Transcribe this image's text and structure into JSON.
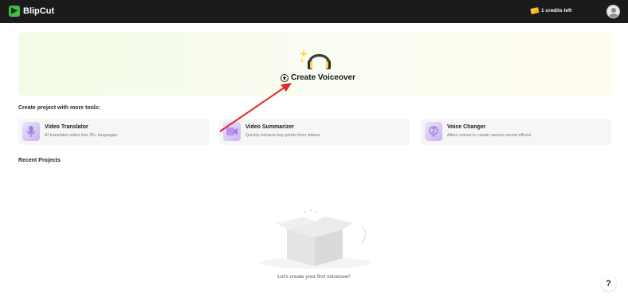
{
  "header": {
    "app_name": "BlipCut",
    "credits_text": "1 credits left"
  },
  "hero": {
    "create_label": "Create Voiceover"
  },
  "tools_section": {
    "title": "Create project with more tools:",
    "tools": [
      {
        "name": "Video Translator",
        "description": "AI translates video into 35+ languages",
        "icon": "microphone-icon"
      },
      {
        "name": "Video Summarizer",
        "description": "Quickly extracts key points from videos",
        "icon": "video-play-icon"
      },
      {
        "name": "Voice Changer",
        "description": "Alters voices to create various sound effects",
        "icon": "voice-change-icon"
      }
    ]
  },
  "recent": {
    "title": "Recent Projects",
    "empty_text": "Let's create your first voiceover!"
  },
  "help": {
    "label": "?"
  },
  "colors": {
    "topbar": "#1b1b1b",
    "brand": "#3fbf4a",
    "annotation_arrow": "#e02a2a"
  }
}
